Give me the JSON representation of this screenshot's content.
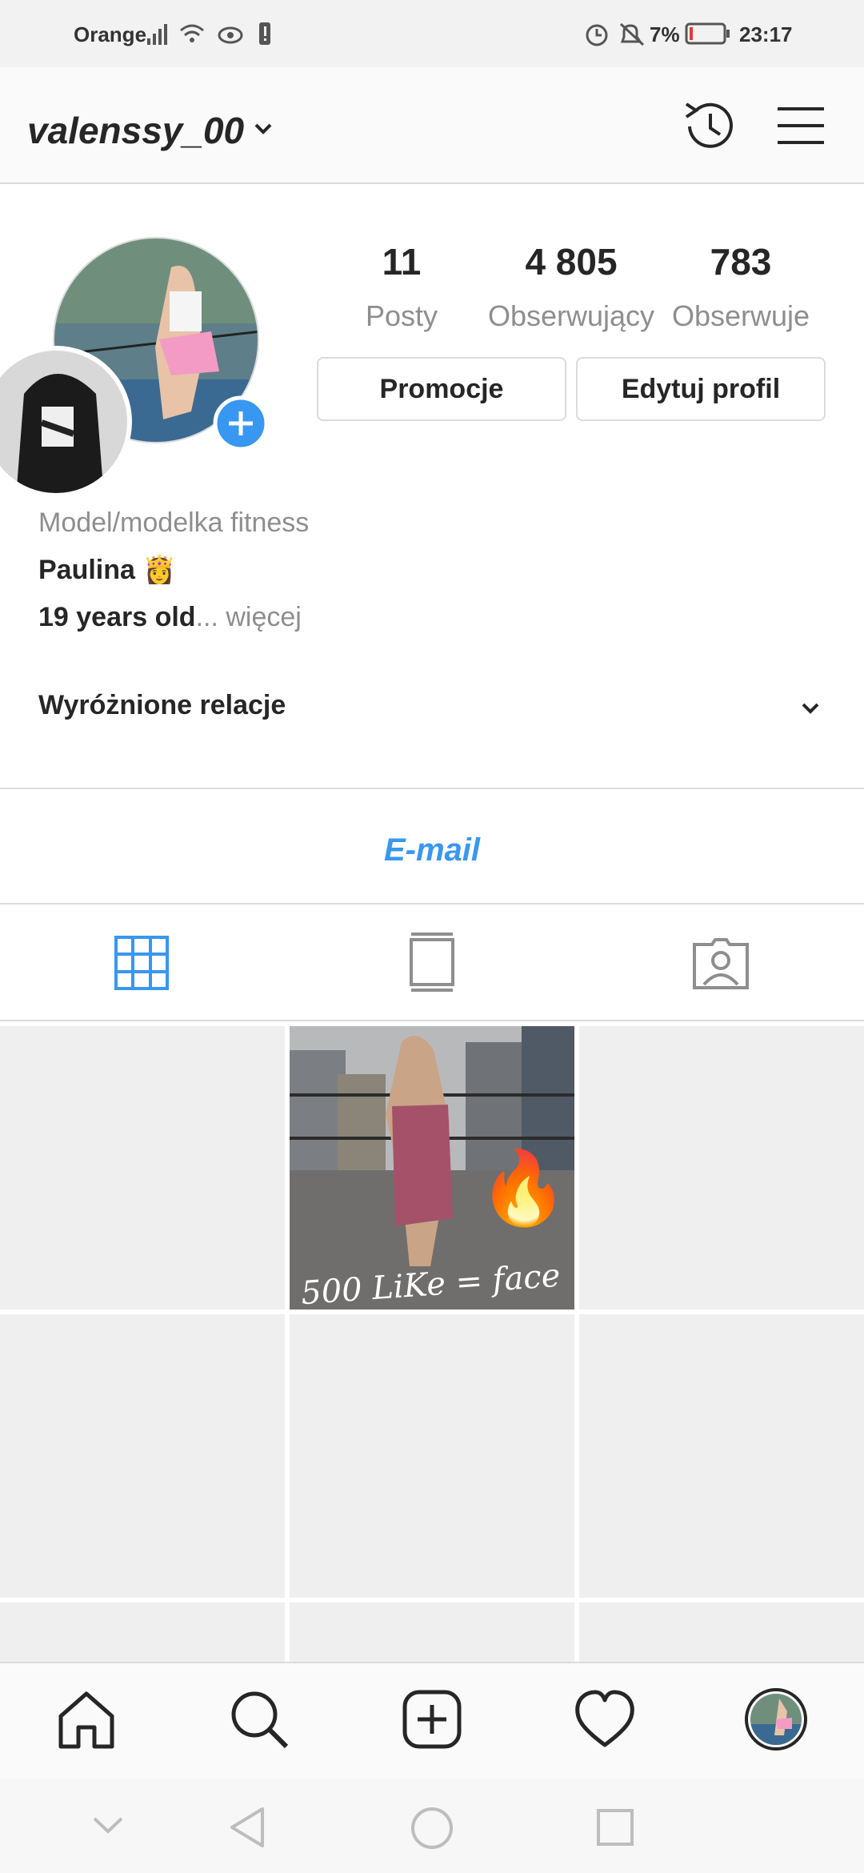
{
  "status_bar": {
    "carrier": "Orange",
    "battery": "7%",
    "time": "23:17"
  },
  "header": {
    "username": "valenssy_00",
    "icons": [
      "chevron-down-icon",
      "history-icon",
      "menu-icon"
    ]
  },
  "profile": {
    "stats": [
      {
        "value": "11",
        "label": "Posty"
      },
      {
        "value": "4 805",
        "label": "Obserwujący"
      },
      {
        "value": "783",
        "label": "Obserwuje"
      }
    ],
    "buttons": {
      "promo": "Promocje",
      "edit": "Edytuj profil"
    },
    "bio": {
      "category": "Model/modelka fitness",
      "name": "Paulina 👸",
      "line": "19 years old",
      "ellipsis": "... więcej"
    },
    "highlights_label": "Wyróżnione relacje",
    "email_label": "E-mail"
  },
  "post": {
    "caption_overlay": "500 LiKe = face",
    "emoji": "🔥"
  },
  "colors": {
    "accent": "#3897f0",
    "placeholder": "#efefef",
    "border": "#dbdbdb"
  }
}
